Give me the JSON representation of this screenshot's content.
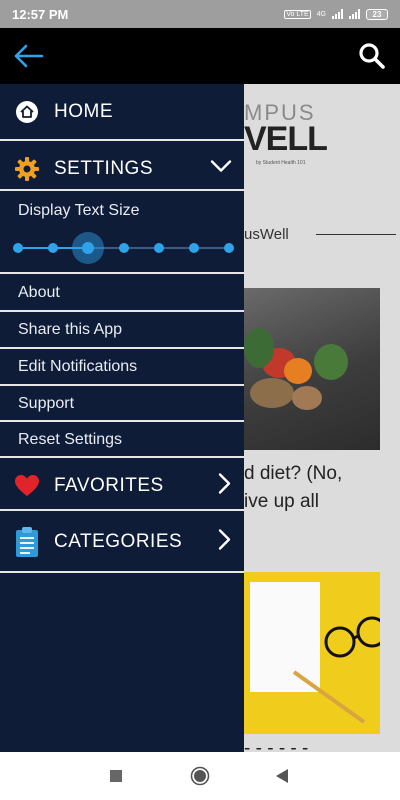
{
  "status_bar": {
    "time": "12:57 PM",
    "network": "4G",
    "volte": "Vo LTE",
    "battery": "23"
  },
  "app_bar": {
    "back_icon": "arrow-left-icon",
    "search_icon": "search-icon",
    "accent_color": "#2fa3ea"
  },
  "drawer": {
    "background_color": "#0f1c38",
    "items": [
      {
        "label": "HOME",
        "icon": "home-icon"
      },
      {
        "label": "SETTINGS",
        "icon": "gear-icon",
        "expanded": true
      },
      {
        "label": "FAVORITES",
        "icon": "heart-icon"
      },
      {
        "label": "CATEGORIES",
        "icon": "clipboard-icon"
      }
    ],
    "settings": {
      "text_size_label": "Display Text Size",
      "text_size_steps": 7,
      "text_size_selected_step": 3,
      "options": [
        "About",
        "Share this App",
        "Edit Notifications",
        "Support",
        "Reset Settings"
      ]
    }
  },
  "background": {
    "logo_top": "MPUS",
    "logo_bottom": "VELL",
    "logo_tagline": "by Student Health 101",
    "brand_text": "usWell",
    "article_1_title_lines": [
      "d diet? (No,",
      "ive up all"
    ],
    "article_2_title": "- - - - - -"
  },
  "nav_bar": {
    "icons": [
      "recent-apps-icon",
      "home-circle-icon",
      "back-triangle-icon"
    ]
  }
}
